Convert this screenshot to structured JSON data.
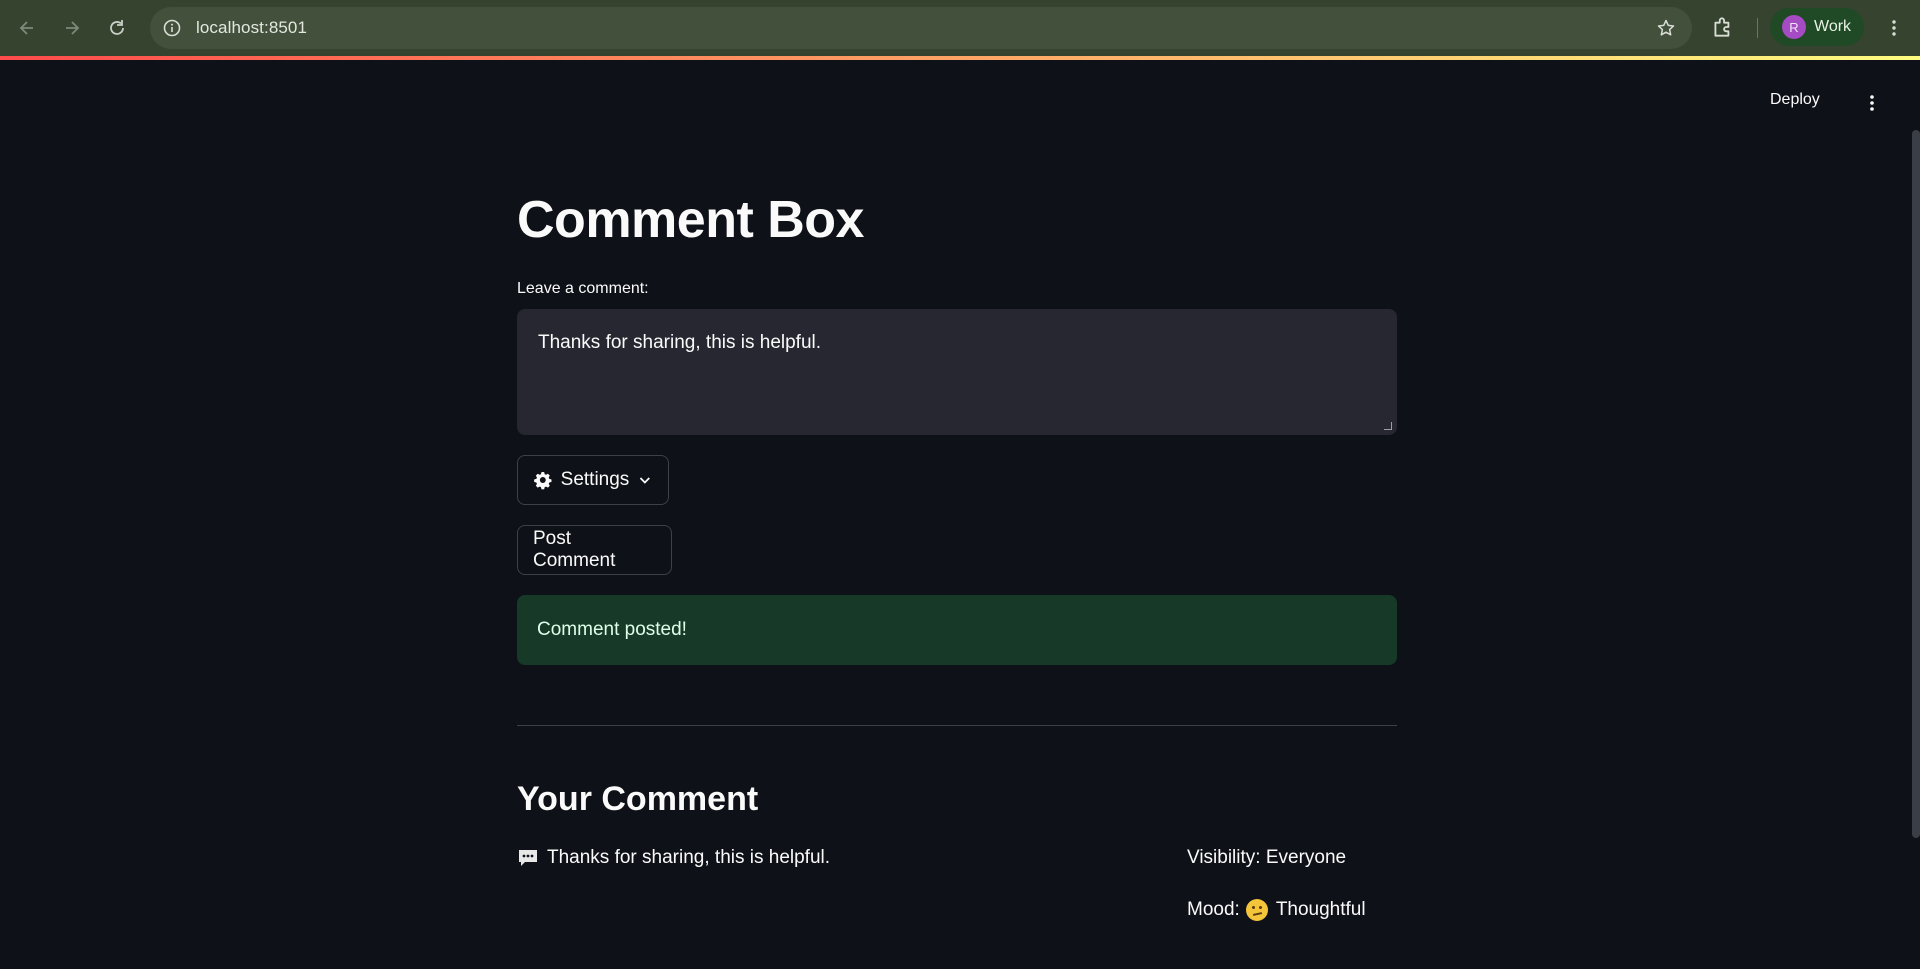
{
  "browser": {
    "url": "localhost:8501",
    "profile_initial": "R",
    "profile_label": "Work"
  },
  "app_header": {
    "deploy_label": "Deploy"
  },
  "main": {
    "title": "Comment Box",
    "comment_label": "Leave a comment:",
    "comment_value": "Thanks for sharing, this is helpful.",
    "settings_label": "Settings",
    "post_button_label": "Post Comment",
    "success_message": "Comment posted!",
    "section_title": "Your Comment",
    "posted_comment": "Thanks for sharing, this is helpful.",
    "visibility_text": "Visibility: Everyone",
    "mood_label": "Mood:",
    "mood_value": "Thoughtful"
  },
  "icons": {
    "back": "arrow-left-icon",
    "forward": "arrow-right-icon",
    "reload": "reload-icon",
    "info": "info-icon",
    "bookmark": "star-icon",
    "extensions": "puzzle-icon",
    "menu": "kebab-menu-icon",
    "settings": "gear-icon",
    "comment": "speech-bubble-icon",
    "mood": "thinking-face-icon"
  },
  "colors": {
    "background": "#0e1117",
    "input_bg": "#262730",
    "success_bg": "#173928",
    "chrome_bg": "#35432f"
  }
}
